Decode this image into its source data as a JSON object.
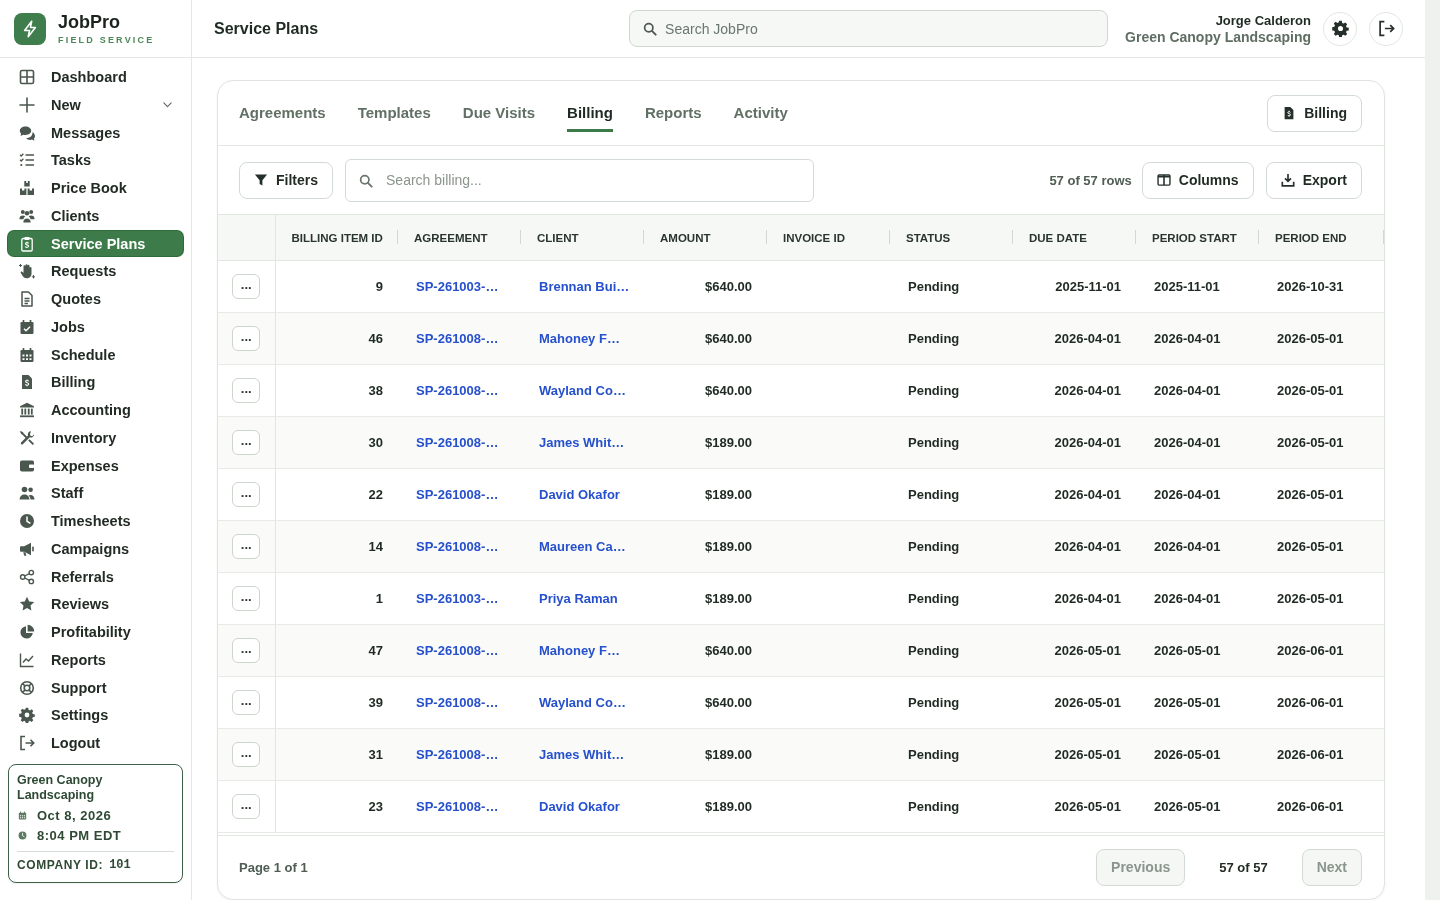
{
  "sidebar": {
    "brand": {
      "name": "JobPro",
      "tagline": "FIELD SERVICE"
    },
    "items": [
      {
        "label": "Dashboard",
        "kind": "link",
        "selected": false
      },
      {
        "label": "New",
        "kind": "group",
        "expanded": false,
        "selected": false
      },
      {
        "label": "Messages",
        "kind": "link",
        "selected": false
      },
      {
        "label": "Tasks",
        "kind": "link",
        "selected": false
      },
      {
        "label": "Price Book",
        "kind": "link",
        "selected": false
      },
      {
        "label": "Clients",
        "kind": "link",
        "selected": false
      },
      {
        "label": "Service Plans",
        "kind": "link",
        "selected": true
      },
      {
        "label": "Requests",
        "kind": "link",
        "selected": false
      },
      {
        "label": "Quotes",
        "kind": "link",
        "selected": false
      },
      {
        "label": "Jobs",
        "kind": "link",
        "selected": false
      },
      {
        "label": "Schedule",
        "kind": "link",
        "selected": false
      },
      {
        "label": "Billing",
        "kind": "link",
        "selected": false
      },
      {
        "label": "Accounting",
        "kind": "link",
        "selected": false
      },
      {
        "label": "Inventory",
        "kind": "link",
        "selected": false
      },
      {
        "label": "Expenses",
        "kind": "link",
        "selected": false
      },
      {
        "label": "Staff",
        "kind": "link",
        "selected": false
      },
      {
        "label": "Timesheets",
        "kind": "link",
        "selected": false
      },
      {
        "label": "Campaigns",
        "kind": "link",
        "selected": false
      },
      {
        "label": "Referrals",
        "kind": "link",
        "selected": false
      },
      {
        "label": "Reviews",
        "kind": "link",
        "selected": false
      },
      {
        "label": "Profitability",
        "kind": "link",
        "selected": false
      },
      {
        "label": "Reports",
        "kind": "link",
        "selected": false
      },
      {
        "label": "Support",
        "kind": "link",
        "selected": false
      },
      {
        "label": "Settings",
        "kind": "link",
        "selected": false
      },
      {
        "label": "Logout",
        "kind": "link",
        "selected": false
      }
    ],
    "company_card": {
      "name": "Green Canopy Landscaping",
      "date": "Oct 8, 2026",
      "time": "8:04 PM EDT",
      "id_label": "COMPANY ID:",
      "id_value": "101"
    }
  },
  "header": {
    "title": "Service Plans",
    "search": {
      "placeholder": "Search JobPro"
    },
    "user": {
      "name": "Jorge Calderon",
      "company": "Green Canopy Landscaping"
    }
  },
  "tabs": [
    {
      "label": "Agreements",
      "selected": false
    },
    {
      "label": "Templates",
      "selected": false
    },
    {
      "label": "Due Visits",
      "selected": false
    },
    {
      "label": "Billing",
      "selected": true
    },
    {
      "label": "Reports",
      "selected": false
    },
    {
      "label": "Activity",
      "selected": false
    }
  ],
  "billing_button": "Billing",
  "toolbar": {
    "filters_button": "Filters",
    "search": {
      "placeholder": "Search billing..."
    },
    "row_count": "57 of 57 rows",
    "columns_button": "Columns",
    "export_button": "Export"
  },
  "table": {
    "columns": [
      "BILLING ITEM ID",
      "AGREEMENT",
      "CLIENT",
      "AMOUNT",
      "INVOICE ID",
      "STATUS",
      "DUE DATE",
      "PERIOD START",
      "PERIOD END"
    ],
    "rows": [
      {
        "menu_button": "...",
        "billing_item_id": "9",
        "agreement": "SP-261003-…",
        "client": "Brennan Bui…",
        "amount": "$640.00",
        "status": "Pending",
        "due_date": "2025-11-01",
        "period_start": "2025-11-01",
        "period_end": "2026-10-31"
      },
      {
        "menu_button": "...",
        "billing_item_id": "46",
        "agreement": "SP-261008-…",
        "client": "Mahoney F…",
        "amount": "$640.00",
        "status": "Pending",
        "due_date": "2026-04-01",
        "period_start": "2026-04-01",
        "period_end": "2026-05-01"
      },
      {
        "menu_button": "...",
        "billing_item_id": "38",
        "agreement": "SP-261008-…",
        "client": "Wayland Co…",
        "amount": "$640.00",
        "status": "Pending",
        "due_date": "2026-04-01",
        "period_start": "2026-04-01",
        "period_end": "2026-05-01"
      },
      {
        "menu_button": "...",
        "billing_item_id": "30",
        "agreement": "SP-261008-…",
        "client": "James Whit…",
        "amount": "$189.00",
        "status": "Pending",
        "due_date": "2026-04-01",
        "period_start": "2026-04-01",
        "period_end": "2026-05-01"
      },
      {
        "menu_button": "...",
        "billing_item_id": "22",
        "agreement": "SP-261008-…",
        "client": "David Okafor",
        "amount": "$189.00",
        "status": "Pending",
        "due_date": "2026-04-01",
        "period_start": "2026-04-01",
        "period_end": "2026-05-01"
      },
      {
        "menu_button": "...",
        "billing_item_id": "14",
        "agreement": "SP-261008-…",
        "client": "Maureen Ca…",
        "amount": "$189.00",
        "status": "Pending",
        "due_date": "2026-04-01",
        "period_start": "2026-04-01",
        "period_end": "2026-05-01"
      },
      {
        "menu_button": "...",
        "billing_item_id": "1",
        "agreement": "SP-261003-…",
        "client": "Priya Raman",
        "amount": "$189.00",
        "status": "Pending",
        "due_date": "2026-04-01",
        "period_start": "2026-04-01",
        "period_end": "2026-05-01"
      },
      {
        "menu_button": "...",
        "billing_item_id": "47",
        "agreement": "SP-261008-…",
        "client": "Mahoney F…",
        "amount": "$640.00",
        "status": "Pending",
        "due_date": "2026-05-01",
        "period_start": "2026-05-01",
        "period_end": "2026-06-01"
      },
      {
        "menu_button": "...",
        "billing_item_id": "39",
        "agreement": "SP-261008-…",
        "client": "Wayland Co…",
        "amount": "$640.00",
        "status": "Pending",
        "due_date": "2026-05-01",
        "period_start": "2026-05-01",
        "period_end": "2026-06-01"
      },
      {
        "menu_button": "...",
        "billing_item_id": "31",
        "agreement": "SP-261008-…",
        "client": "James Whit…",
        "amount": "$189.00",
        "status": "Pending",
        "due_date": "2026-05-01",
        "period_start": "2026-05-01",
        "period_end": "2026-06-01"
      },
      {
        "menu_button": "...",
        "billing_item_id": "23",
        "agreement": "SP-261008-…",
        "client": "David Okafor",
        "amount": "$189.00",
        "status": "Pending",
        "due_date": "2026-05-01",
        "period_start": "2026-05-01",
        "period_end": "2026-06-01"
      }
    ]
  },
  "pagination": {
    "page": "Page 1 of 1",
    "previous": {
      "label": "Previous",
      "disabled": true
    },
    "count": "57 of 57",
    "next": {
      "label": "Next",
      "disabled": true
    }
  }
}
